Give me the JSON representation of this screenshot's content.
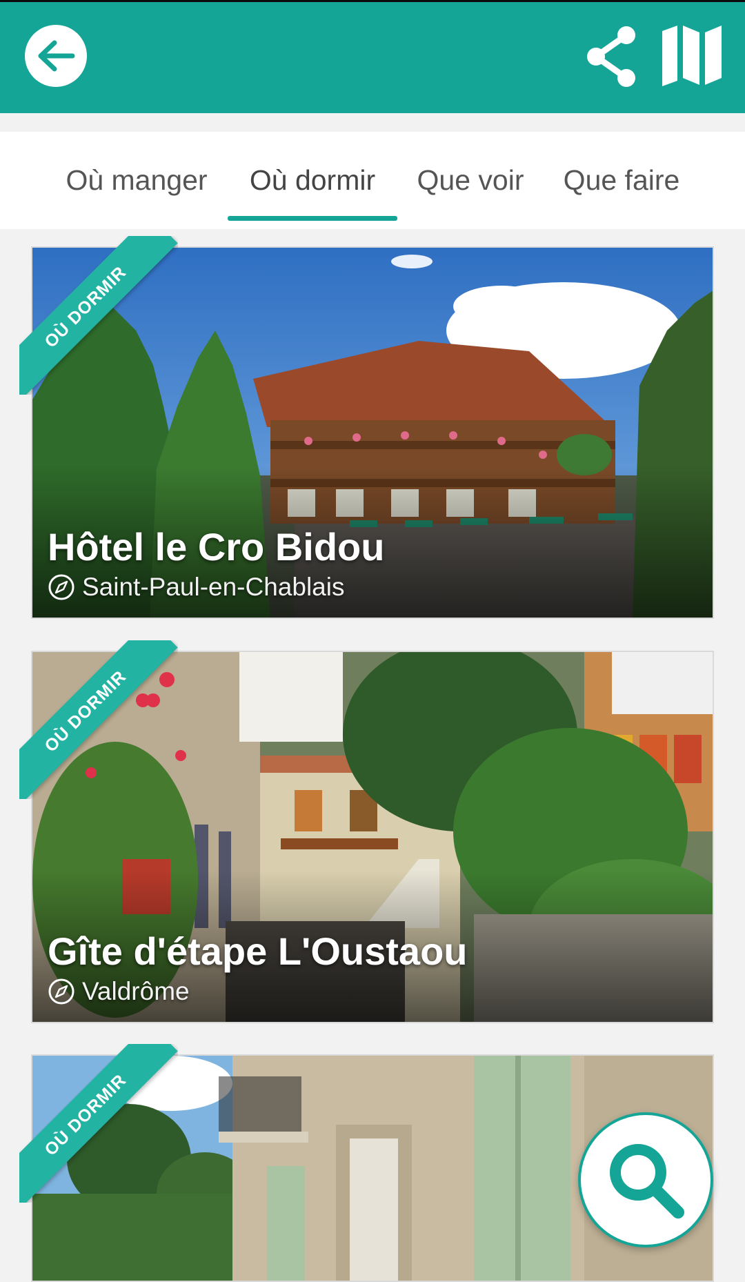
{
  "theme": {
    "primary": "#14a597",
    "ribbon": "#22b3a3"
  },
  "header": {
    "back_icon": "arrow-left-icon",
    "share_icon": "share-icon",
    "map_icon": "map-icon"
  },
  "tabs": [
    {
      "label": "Où manger",
      "active": false
    },
    {
      "label": "Où dormir",
      "active": true
    },
    {
      "label": "Que voir",
      "active": false
    },
    {
      "label": "Que faire",
      "active": false
    }
  ],
  "listings": [
    {
      "ribbon": "OÙ DORMIR",
      "title": "Hôtel le Cro Bidou",
      "location": "Saint-Paul-en-Chablais",
      "location_icon": "compass-icon"
    },
    {
      "ribbon": "OÙ DORMIR",
      "title": "Gîte d'étape L'Oustaou",
      "location": "Valdrôme",
      "location_icon": "compass-icon"
    },
    {
      "ribbon": "OÙ DORMIR",
      "title": "",
      "location": "",
      "location_icon": "compass-icon"
    }
  ],
  "fab": {
    "icon": "search-icon"
  }
}
